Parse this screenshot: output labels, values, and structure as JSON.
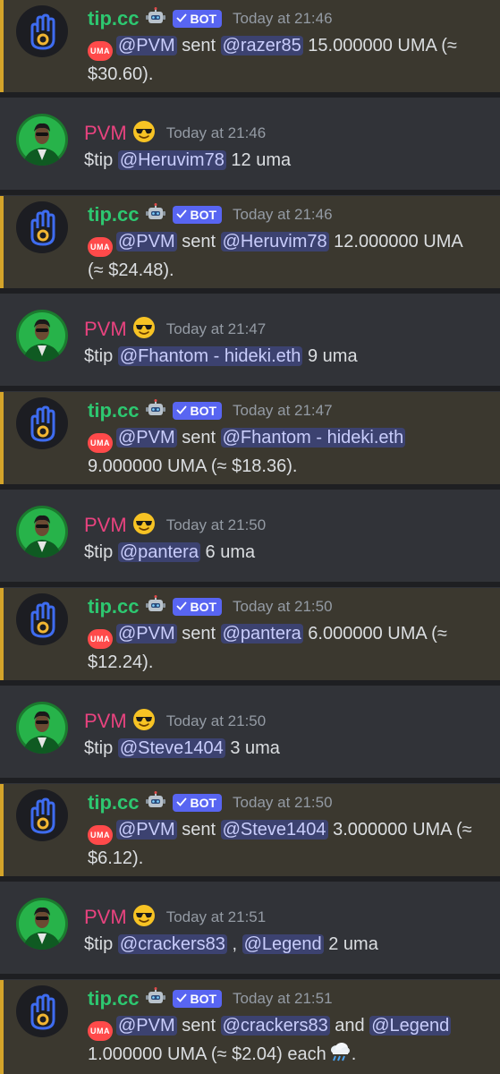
{
  "colors": {
    "bot_name": "#2dc770",
    "user_name": "#e8437f",
    "bot_highlight": "#d4a42a",
    "badge": "#5865f2",
    "mention_bg": "#3c4270"
  },
  "bot_badge": "BOT",
  "uma_logo_text": "UMA",
  "messages": [
    {
      "kind": "bot",
      "author": "tip.cc",
      "time": "Today at 21:46",
      "sender": "@PVM",
      "verb": "sent",
      "recipients": [
        "@razer85"
      ],
      "joiner": "",
      "amount_line1": "15.000000 UMA (≈",
      "amount_line2": "$30.60).",
      "each": ""
    },
    {
      "kind": "user",
      "author": "PVM",
      "time": "Today at 21:46",
      "cmd": "$tip",
      "mentions": [
        "@Heruvim78"
      ],
      "amount": "12 uma"
    },
    {
      "kind": "bot",
      "author": "tip.cc",
      "time": "Today at 21:46",
      "sender": "@PVM",
      "verb": "sent",
      "recipients": [
        "@Heruvim78"
      ],
      "joiner": "",
      "amount_line1": "12.000000 UMA",
      "amount_line2": "(≈ $24.48).",
      "each": ""
    },
    {
      "kind": "user",
      "author": "PVM",
      "time": "Today at 21:47",
      "cmd": "$tip",
      "mentions": [
        "@Fhantom - hideki.eth"
      ],
      "amount": "9 uma"
    },
    {
      "kind": "bot",
      "author": "tip.cc",
      "time": "Today at 21:47",
      "sender": "@PVM",
      "verb": "sent",
      "recipients": [
        "@Fhantom - hideki.eth"
      ],
      "joiner": "",
      "amount_line1": "",
      "amount_line2": "9.000000 UMA (≈ $18.36).",
      "each": ""
    },
    {
      "kind": "user",
      "author": "PVM",
      "time": "Today at 21:50",
      "cmd": "$tip",
      "mentions": [
        "@pantera"
      ],
      "amount": "6 uma"
    },
    {
      "kind": "bot",
      "author": "tip.cc",
      "time": "Today at 21:50",
      "sender": "@PVM",
      "verb": "sent",
      "recipients": [
        "@pantera"
      ],
      "joiner": "",
      "amount_line1": "6.000000 UMA (≈",
      "amount_line2": "$12.24).",
      "each": ""
    },
    {
      "kind": "user",
      "author": "PVM",
      "time": "Today at 21:50",
      "cmd": "$tip",
      "mentions": [
        "@Steve1404"
      ],
      "amount": "3 uma"
    },
    {
      "kind": "bot",
      "author": "tip.cc",
      "time": "Today at 21:50",
      "sender": "@PVM",
      "verb": "sent",
      "recipients": [
        "@Steve1404"
      ],
      "joiner": "",
      "amount_line1": "3.000000 UMA (≈",
      "amount_line2": "$6.12).",
      "each": ""
    },
    {
      "kind": "user",
      "author": "PVM",
      "time": "Today at 21:51",
      "cmd": "$tip",
      "mentions": [
        "@crackers83",
        "@Legend"
      ],
      "separator": ",",
      "amount": "2 uma"
    },
    {
      "kind": "bot",
      "author": "tip.cc",
      "time": "Today at 21:51",
      "sender": "@PVM",
      "verb": "sent",
      "recipients": [
        "@crackers83",
        "@Legend"
      ],
      "joiner": "and",
      "amount_line1": "",
      "amount_line2": "1.000000 UMA (≈ $2.04) each",
      "each": "."
    }
  ]
}
